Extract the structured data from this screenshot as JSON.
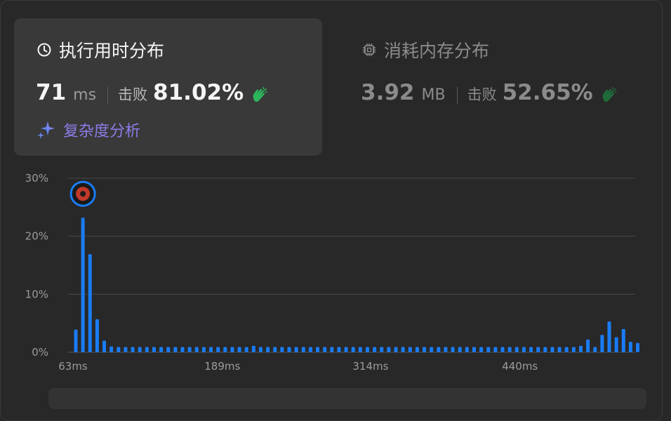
{
  "runtime": {
    "title": "执行用时分布",
    "value": "71",
    "unit": "ms",
    "beat_label": "击败",
    "beat_percent": "81.02%",
    "analysis_label": "复杂度分析",
    "icon": "clock-icon"
  },
  "memory": {
    "title": "消耗内存分布",
    "value": "3.92",
    "unit": "MB",
    "beat_label": "击败",
    "beat_percent": "52.65%",
    "icon": "chip-icon"
  },
  "colors": {
    "bar": "#1a7cf5",
    "grid": "#484848",
    "accent_purple": "#8a7ce8",
    "clap_green": "#2db55d"
  },
  "chart_data": {
    "type": "bar",
    "y_ticks": [
      "30%",
      "20%",
      "10%",
      "0%"
    ],
    "ylim": [
      0,
      30
    ],
    "x_ticks": [
      "63ms",
      "189ms",
      "314ms",
      "440ms"
    ],
    "x_tick_values": [
      63,
      189,
      314,
      440
    ],
    "xlim": [
      63,
      542
    ],
    "grid": true,
    "x": [
      63,
      69,
      75,
      81,
      87,
      93,
      99,
      105,
      111,
      117,
      123,
      129,
      135,
      141,
      147,
      153,
      159,
      165,
      171,
      177,
      183,
      189,
      195,
      201,
      207,
      213,
      219,
      225,
      231,
      237,
      243,
      249,
      255,
      261,
      267,
      273,
      279,
      285,
      291,
      297,
      303,
      309,
      315,
      321,
      327,
      333,
      339,
      345,
      351,
      357,
      363,
      369,
      375,
      381,
      387,
      393,
      399,
      405,
      411,
      417,
      423,
      429,
      435,
      441,
      447,
      453,
      459,
      465,
      471,
      477,
      483,
      489,
      495,
      501,
      507,
      513,
      519,
      525,
      531,
      537
    ],
    "values": [
      3.9,
      23.2,
      16.9,
      5.7,
      2.0,
      1.0,
      0.9,
      0.9,
      0.9,
      0.9,
      0.9,
      0.9,
      0.9,
      0.9,
      0.9,
      0.9,
      0.9,
      0.9,
      0.9,
      0.9,
      0.9,
      0.9,
      0.9,
      0.9,
      0.9,
      1.1,
      0.9,
      0.9,
      0.9,
      0.9,
      0.9,
      0.9,
      0.9,
      0.9,
      0.9,
      0.9,
      0.9,
      0.9,
      0.9,
      0.9,
      0.9,
      0.9,
      0.9,
      0.9,
      0.9,
      0.9,
      0.9,
      0.9,
      0.9,
      0.9,
      0.9,
      0.9,
      0.9,
      0.9,
      0.9,
      0.9,
      0.9,
      0.9,
      0.9,
      0.9,
      0.9,
      0.9,
      0.9,
      0.9,
      0.9,
      0.9,
      0.9,
      0.9,
      0.9,
      0.9,
      0.9,
      1.1,
      2.2,
      0.9,
      3.0,
      5.3,
      2.6,
      4.0,
      1.8,
      1.6,
      0.9
    ],
    "highlight_x": 71
  }
}
